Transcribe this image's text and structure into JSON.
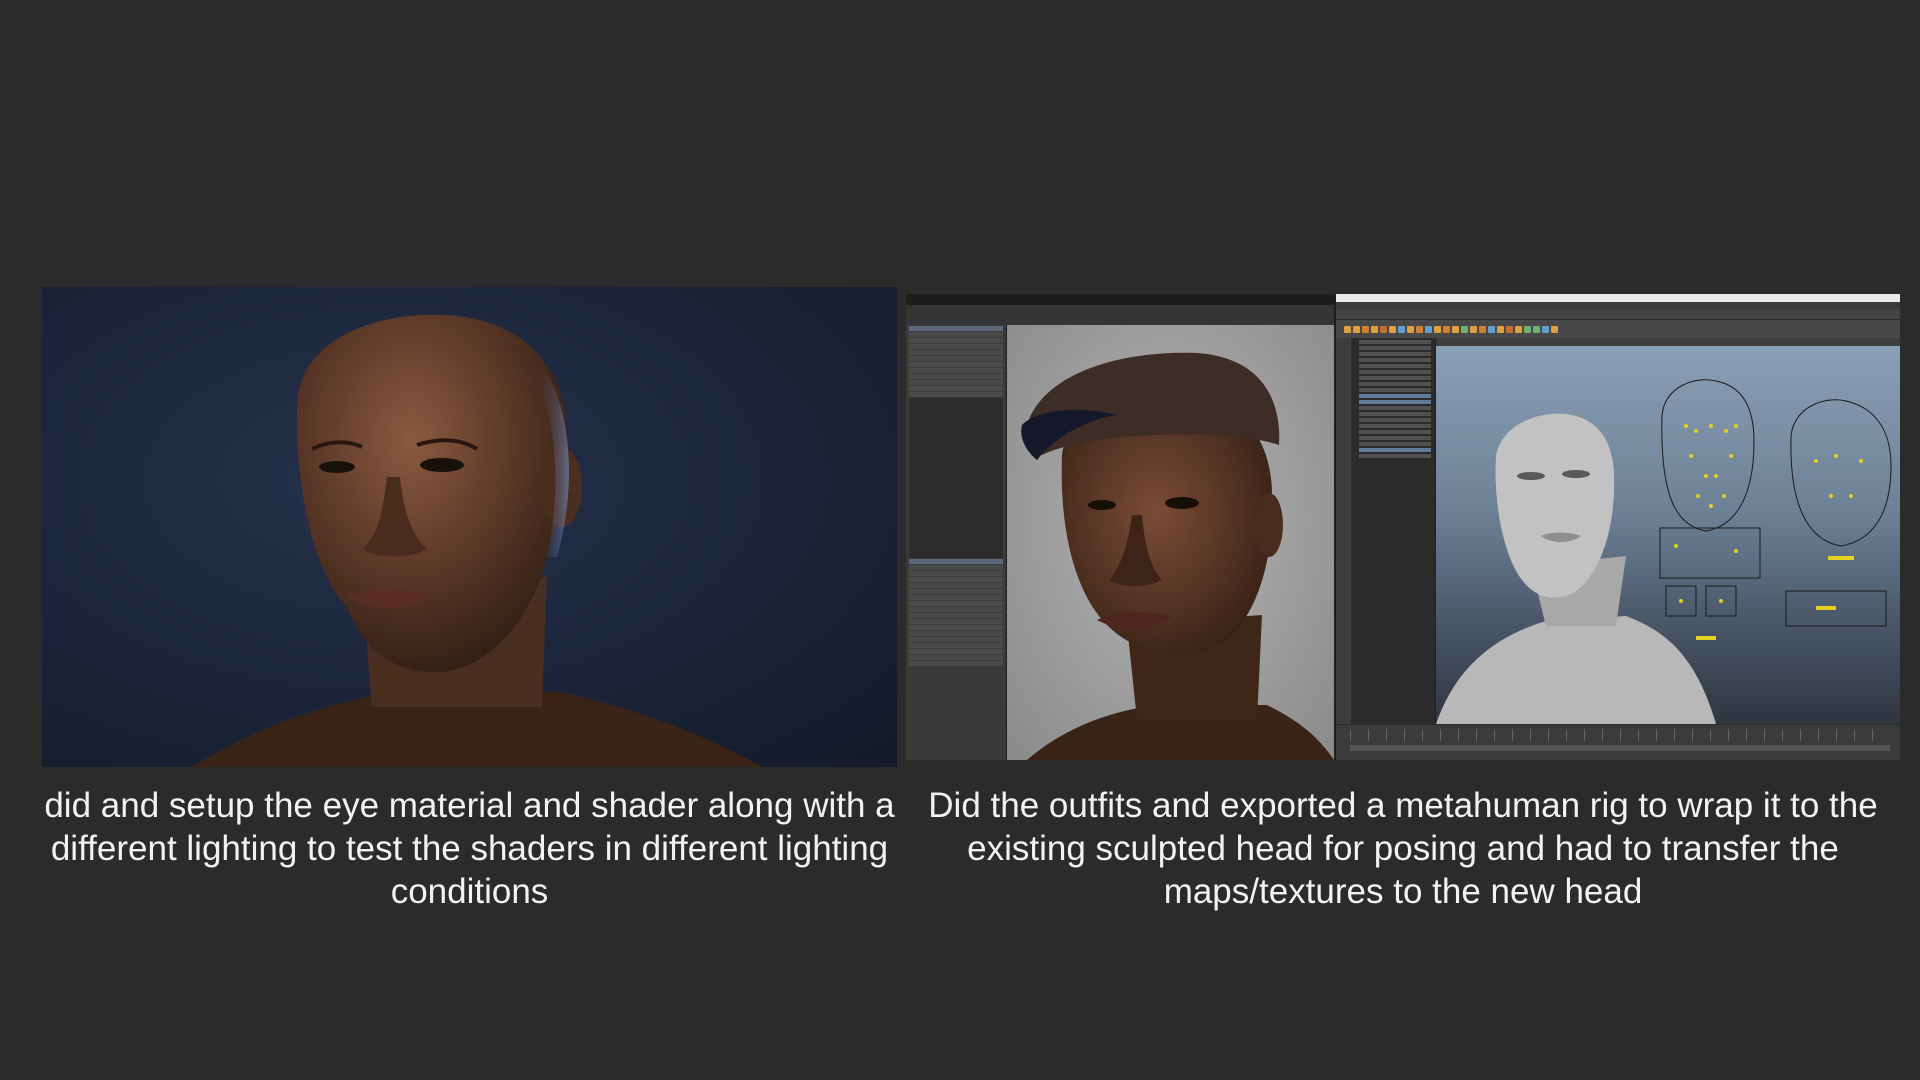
{
  "slide": {
    "background": "#2b2b2b",
    "left_panel": {
      "image": "3d-render-bald-head-blue-background",
      "caption": "did and setup the eye material and shader along with a different lighting to test the shaders in different lighting conditions"
    },
    "right_panel": {
      "image": "software-screenshots-texturing-and-rigging",
      "caption": "Did the outfits and exported a metahuman rig to wrap it to the existing sculpted head for posing and had to transfer the maps/textures to the new head"
    }
  },
  "colors": {
    "text": "#f2f2f2",
    "render_bg": "#1b2439",
    "maya_accent": "#f0c020"
  }
}
